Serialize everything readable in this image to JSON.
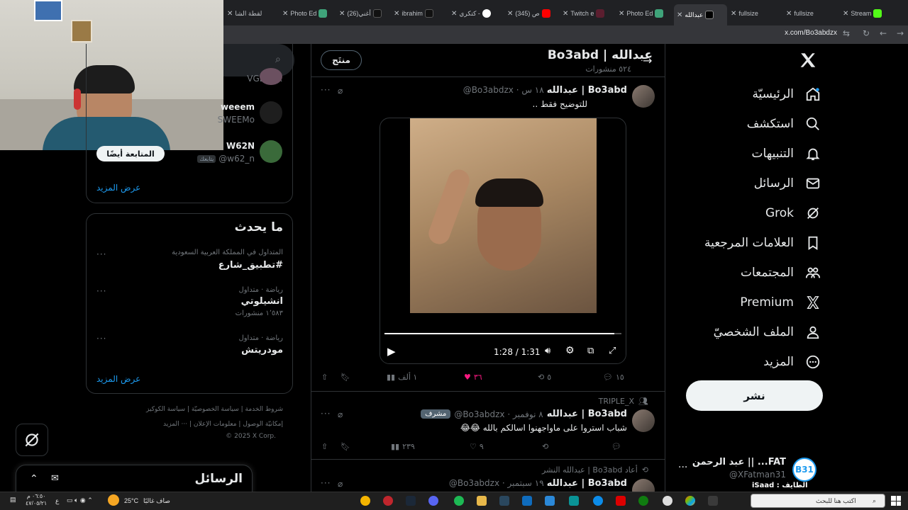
{
  "browser": {
    "tabs": [
      "لقطة الشا",
      "Photo Ed",
      "(26)أغني",
      "ibrahim",
      "كتكري -",
      "(345) ص",
      "Twitch e",
      "Photo Ed",
      "عبدالله",
      "fullsize",
      "fullsize",
      "Stream"
    ],
    "url": "x.com/Bo3abdzx"
  },
  "nav": {
    "items": [
      "الرئيسيّة",
      "استكشف",
      "التنبيهات",
      "الرسائل",
      "Grok",
      "العلامات المرجعية",
      "المجتمعات",
      "Premium",
      "الملف الشخصيّ",
      "المزيد"
    ],
    "post_label": "نشر",
    "account_name": "FAT... || عبد الرحمن",
    "account_handle": "@XFatman31"
  },
  "header": {
    "title": "Bo3abd | عبدالله",
    "posts_count": "٥٢٤ منشورات",
    "products_label": "منتَج"
  },
  "tweet1": {
    "name": "Bo3abd | عبدالله",
    "handle": "@Bo3abdzx · ١٨ س",
    "text": "للتوضيح فقط ..",
    "video_time": "1:28 / 1:31",
    "video_progress": 0.97,
    "replies": "١٥",
    "retweets": "٥",
    "likes": "٣٦",
    "views": "١ ألف"
  },
  "tweet2": {
    "community": "TRIPLE_X",
    "badge": "مشرف",
    "name": "Bo3abd | عبدالله",
    "handle": "@Bo3abdzx · ٨ نوفمبر",
    "text": "شباب استروا على ماواجهنوا اسالكم بالله 😂😂",
    "likes": "٩",
    "views": "٢٣٩"
  },
  "tweet3": {
    "retweeted_by": "أعاد Bo3abd | عبدالله النشر",
    "name": "Bo3abd | عبدالله",
    "handle": "@Bo3abdzx · ١٩ سبتمبر"
  },
  "sidebar": {
    "search_icon": "search-icon",
    "who_to_follow": [
      {
        "name": "",
        "handle": "VGEXXX"
      },
      {
        "name": "weeem",
        "handle": "SWEEMo"
      },
      {
        "name": "W62N",
        "handle": "@w62_n",
        "follows_you": "يتابعك"
      }
    ],
    "follow_back": "المتابعة أيضًا",
    "show_more": "عرض المزيد",
    "trends_title": "ما يحدث",
    "trends": [
      {
        "context": "المتداول في المملكة العربية السعودية",
        "name": "#تطبيق_شارع",
        "count": ""
      },
      {
        "context": "رياضة · متداول",
        "name": "انشيلوتي",
        "count": "١٬٥٨٣ منشورات"
      },
      {
        "context": "رياضة · متداول",
        "name": "مودريتش",
        "count": ""
      }
    ],
    "show_more_2": "عرض المزيد",
    "footer": [
      "شروط الخدمة",
      "سياسة الخصوصيّة",
      "سياسة الكوكيز",
      "إمكانيّة الوصول",
      "معلومات الإعلان",
      "··· المزيد",
      "© 2025 X Corp."
    ],
    "messages_label": "الرسائل"
  },
  "taskbar": {
    "weather": "صاف غالبًا",
    "temp": "25°C",
    "search_placeholder": "اكتب هنا للبحث",
    "time": "٠٦:٥٠ م",
    "date": "٤٧/٠٥/٢١",
    "lang": "ع",
    "streamer_label": "الطايف : iSaad"
  }
}
